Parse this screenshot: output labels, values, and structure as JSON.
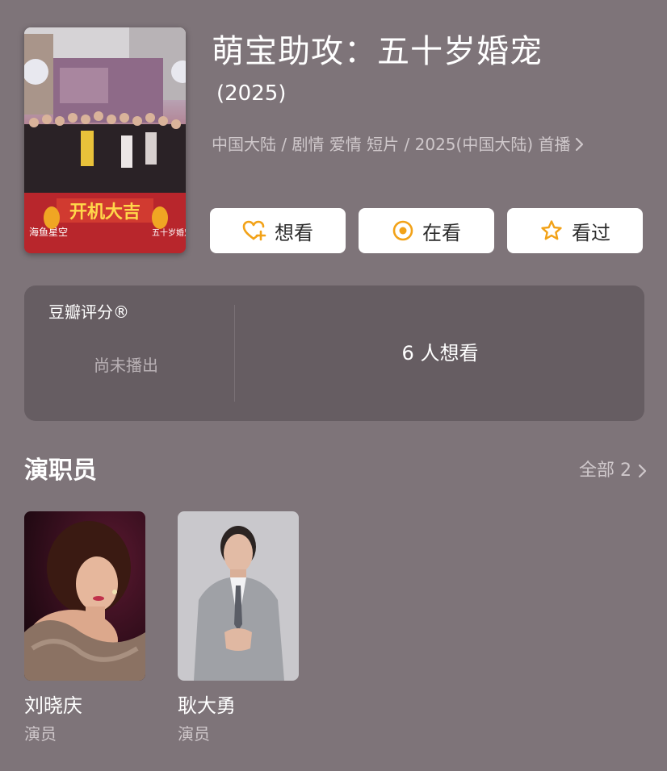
{
  "movie": {
    "poster": {
      "banner_text": "开机大吉",
      "logo_left": "海鱼星空",
      "logo_right": "五十岁婚宠"
    },
    "title": "萌宝助攻：五十岁婚宠",
    "year": "(2025)",
    "meta": "中国大陆 / 剧情 爱情 短片 / 2025(中国大陆) 首播"
  },
  "actions": [
    {
      "label": "想看",
      "icon": "heart-plus-icon"
    },
    {
      "label": "在看",
      "icon": "target-circle-icon"
    },
    {
      "label": "看过",
      "icon": "star-icon"
    }
  ],
  "rating": {
    "title": "豆瓣评分®",
    "status": "尚未播出",
    "want_count": "6 人想看"
  },
  "cast": {
    "heading": "演职员",
    "all_label": "全部 2",
    "members": [
      {
        "name": "刘晓庆",
        "role": "演员"
      },
      {
        "name": "耿大勇",
        "role": "演员"
      }
    ]
  },
  "colors": {
    "background": "#7e7479",
    "card": "#665d62",
    "accent": "#f2a218",
    "button_bg": "#ffffff"
  }
}
